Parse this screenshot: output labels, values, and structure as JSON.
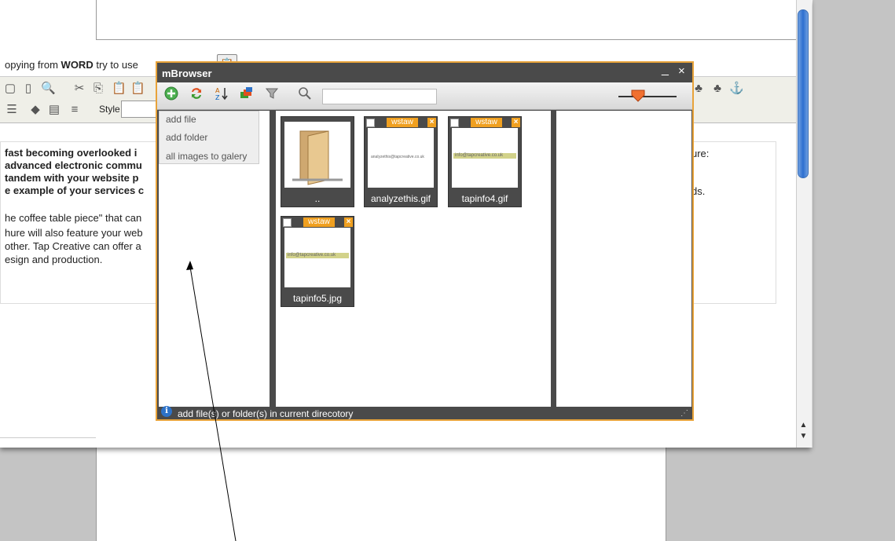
{
  "editor": {
    "word_hint_prefix": "opying from ",
    "word_hint_bold": "WORD",
    "word_hint_suffix": " try to use",
    "style_label": "Style",
    "content_lines": [
      {
        "text": " fast becoming overlooked i",
        "bold": true
      },
      {
        "text": "advanced electronic commu",
        "bold": true
      },
      {
        "text": "tandem with your website p",
        "bold": true
      },
      {
        "text": "e example of your services c",
        "bold": true
      },
      {
        "text": "he coffee table piece\" that can",
        "bold": false
      },
      {
        "text": "hure will also feature your web",
        "bold": false
      },
      {
        "text": " other. Tap Creative can offer a",
        "bold": false
      },
      {
        "text": "esign and production.",
        "bold": false
      }
    ],
    "right_text_1": "ure:",
    "right_text_2": "ds."
  },
  "mbrowser": {
    "title": "mBrowser",
    "minimize": "_",
    "close": "×",
    "menu": {
      "add_file": "add file",
      "add_folder": "add folder",
      "all_images": "all images to galery"
    },
    "status": "add file(s) or folder(s) in current direcotory",
    "insert_label": "wstaw",
    "files": [
      {
        "name": "..",
        "type": "folder"
      },
      {
        "name": "analyzethis.gif",
        "preview_text": "analyzethis@tapcreative.co.uk"
      },
      {
        "name": "tapinfo4.gif",
        "preview_text": "info@tapcreative.co.uk"
      },
      {
        "name": "tapinfo5.jpg",
        "preview_text": "info@tapcreative.co.uk"
      }
    ]
  },
  "colors": {
    "accent_orange": "#f0a020",
    "dialog_border": "#e8a33a",
    "dialog_bg": "#4a4a4a",
    "scroll_blue": "#2d6fd0"
  }
}
